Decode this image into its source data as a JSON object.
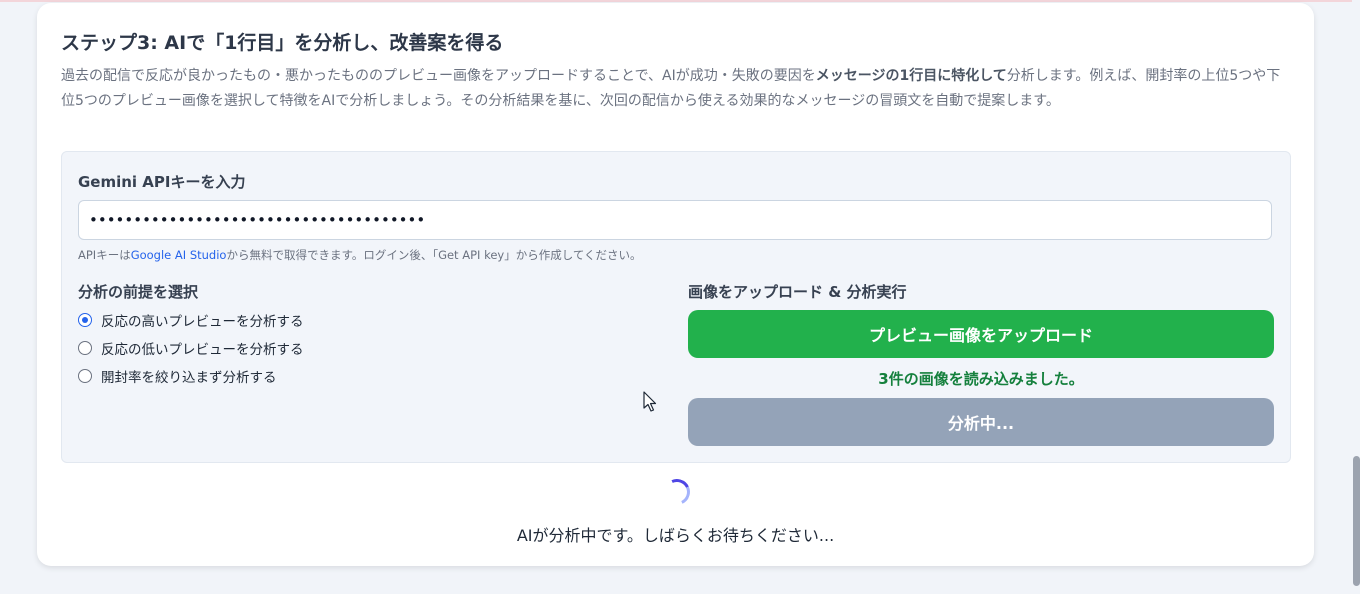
{
  "step": {
    "title": "ステップ3: AIで「1行目」を分析し、改善案を得る",
    "desc_part1": "過去の配信で反応が良かったもの・悪かったもののプレビュー画像をアップロードすることで、AIが成功・失敗の要因を",
    "desc_bold": "メッセージの1行目に特化して",
    "desc_part2": "分析します。例えば、開封率の上位5つや下位5つのプレビュー画像を選択して特徴をAIで分析しましょう。その分析結果を基に、次回の配信から使える効果的なメッセージの冒頭文を自動で提案します。"
  },
  "api": {
    "label": "Gemini APIキーを入力",
    "value": "••••••••••••••••••••••••••••••••••••••",
    "help_prefix": "APIキーは",
    "help_link": "Google AI Studio",
    "help_suffix": "から無料で取得できます。ログイン後、「Get API key」から作成してください。"
  },
  "premise": {
    "label": "分析の前提を選択",
    "options": [
      {
        "label": "反応の高いプレビューを分析する",
        "checked": true
      },
      {
        "label": "反応の低いプレビューを分析する",
        "checked": false
      },
      {
        "label": "開封率を絞り込まず分析する",
        "checked": false
      }
    ]
  },
  "upload": {
    "label": "画像をアップロード & 分析実行",
    "upload_button": "プレビュー画像をアップロード",
    "loaded_text": "3件の画像を読み込みました。",
    "analyze_button": "分析中..."
  },
  "loading": {
    "text": "AIが分析中です。しばらくお待ちください..."
  },
  "colors": {
    "accent_green": "#22b14c",
    "success_text": "#15803d",
    "disabled_gray": "#94a3b8",
    "radio_blue": "#2563eb"
  }
}
